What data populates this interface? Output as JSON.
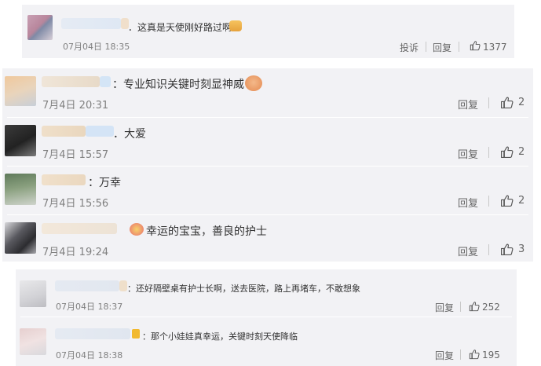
{
  "panel1": {
    "comment": {
      "text": "．这真是天使刚好路过啊",
      "time": "07月04日 18:35",
      "report": "投诉",
      "reply": "回复",
      "likes": "1377"
    }
  },
  "panel2": {
    "comments": [
      {
        "text": "：专业知识关键时刻显神威",
        "time": "7月4日 20:31",
        "reply": "回复",
        "likes": "2"
      },
      {
        "text": "．大爱",
        "time": "7月4日 15:57",
        "reply": "回复",
        "likes": "2"
      },
      {
        "text": "：万幸",
        "time": "7月4日 15:56",
        "reply": "回复",
        "likes": "2"
      },
      {
        "text": "幸运的宝宝，善良的护士",
        "time": "7月4日 19:24",
        "reply": "回复",
        "likes": "3"
      }
    ]
  },
  "panel3": {
    "comments": [
      {
        "text": "：还好隔壁桌有护士长啊，送去医院，路上再堵车，不敢想象",
        "time": "07月04日 18:37",
        "reply": "回复",
        "likes": "252"
      },
      {
        "text": "：那个小娃娃真幸运，关键时刻天使降临",
        "time": "07月04日 18:38",
        "reply": "回复",
        "likes": "195"
      }
    ]
  },
  "colors": {
    "panel_bg": "#f2f2f5",
    "time_gray": "#808080",
    "blur_blue": "#c9def2",
    "blur_tan": "#ecd6b8"
  }
}
